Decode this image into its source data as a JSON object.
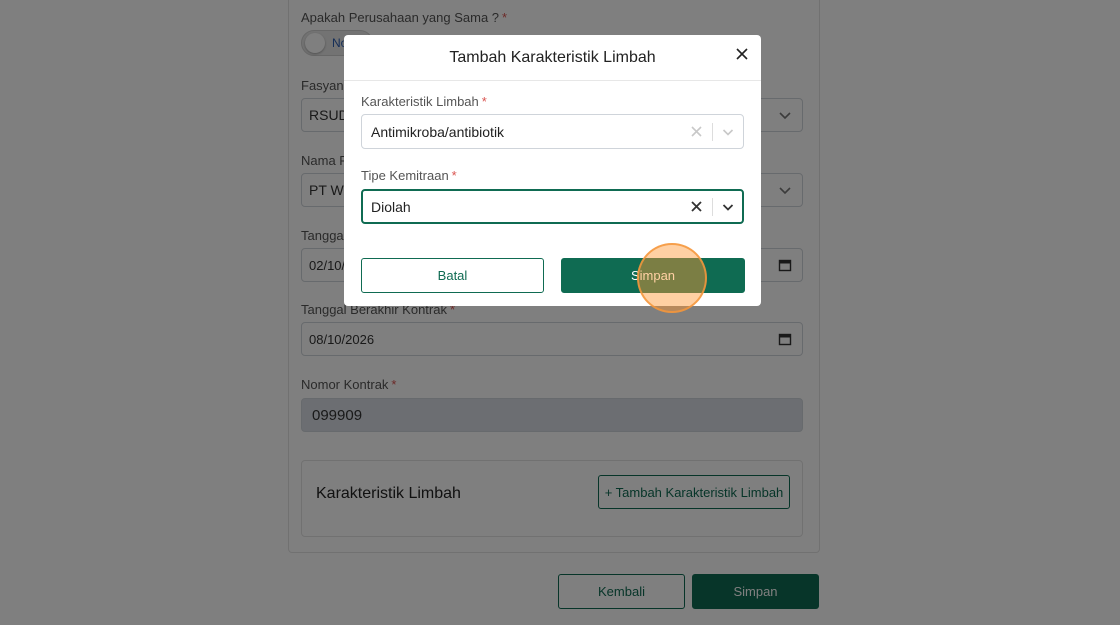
{
  "form": {
    "same_company_label": "Apakah Perusahaan yang Sama ?",
    "same_company_toggle": "No",
    "fasyankes_label": "Fasyank",
    "fasyankes_value": "RSUD",
    "nama_label": "Nama Pe",
    "nama_value": "PT W",
    "tanggal_mulai_label": "Tanggal",
    "tanggal_mulai_value": "02/10/",
    "tanggal_akhir_label": "Tanggal Berakhir Kontrak",
    "tanggal_akhir_value": "08/10/2026",
    "nomor_kontrak_label": "Nomor Kontrak",
    "nomor_kontrak_value": "099909",
    "required_mark": "*"
  },
  "section": {
    "title": "Karakteristik Limbah",
    "add_button": "+ Tambah Karakteristik Limbah"
  },
  "footer": {
    "back_button": "Kembali",
    "save_button": "Simpan"
  },
  "modal": {
    "title": "Tambah Karakteristik Limbah",
    "field1_label": "Karakteristik Limbah",
    "field1_value": "Antimikroba/antibiotik",
    "field2_label": "Tipe Kemitraan",
    "field2_value": "Diolah",
    "cancel_button": "Batal",
    "save_button": "Simpan"
  },
  "colors": {
    "primary": "#0f6b52",
    "overlay": "rgba(0,0,0,0.5)",
    "required": "#d9534f"
  },
  "icons": [
    "close-icon",
    "clear-icon",
    "chevron-down-icon",
    "calendar-icon"
  ]
}
